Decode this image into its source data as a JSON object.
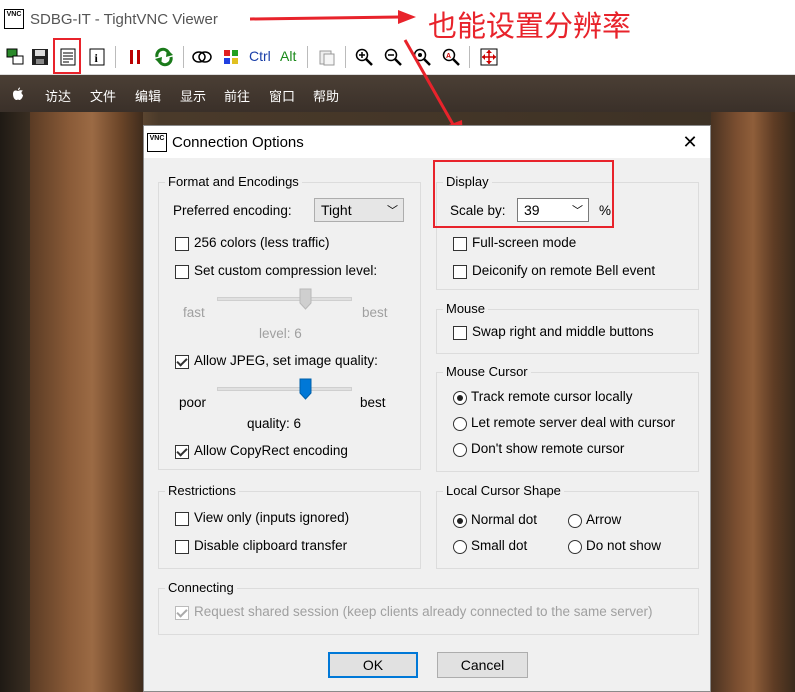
{
  "window": {
    "title": "SDBG-IT - TightVNC Viewer",
    "icon_text": "VNC"
  },
  "annotation": {
    "text": "也能设置分辨率",
    "color": "#e8232b"
  },
  "toolbar": {
    "ctrl_label": "Ctrl",
    "alt_label": "Alt"
  },
  "mac_menu": {
    "items": [
      "访达",
      "文件",
      "编辑",
      "显示",
      "前往",
      "窗口",
      "帮助"
    ]
  },
  "dialog": {
    "title": "Connection Options",
    "icon_text": "VNC",
    "format": {
      "title": "Format and Encodings",
      "preferred_encoding_label": "Preferred encoding:",
      "preferred_encoding_value": "Tight",
      "colors256": {
        "label": "256 colors (less traffic)",
        "checked": false
      },
      "custom_compression": {
        "label": "Set custom compression level:",
        "checked": false
      },
      "compression": {
        "fast": "fast",
        "best": "best",
        "level_text": "level: 6",
        "level": 6,
        "max": 9
      },
      "allow_jpeg": {
        "label": "Allow JPEG, set image quality:",
        "checked": true
      },
      "quality": {
        "poor": "poor",
        "best": "best",
        "quality_text": "quality: 6",
        "level": 6,
        "max": 9
      },
      "copyrect": {
        "label": "Allow CopyRect encoding",
        "checked": true
      }
    },
    "restrictions": {
      "title": "Restrictions",
      "view_only": {
        "label": "View only (inputs ignored)",
        "checked": false
      },
      "disable_clipboard": {
        "label": "Disable clipboard transfer",
        "checked": false
      }
    },
    "connecting": {
      "title": "Connecting",
      "shared": {
        "label": "Request shared session (keep clients already connected to the same server)",
        "checked": true
      }
    },
    "display": {
      "title": "Display",
      "scale_label": "Scale by:",
      "scale_value": "39",
      "percent": "%",
      "fullscreen": {
        "label": "Full-screen mode",
        "checked": false
      },
      "deiconify": {
        "label": "Deiconify on remote Bell event",
        "checked": false
      }
    },
    "mouse": {
      "title": "Mouse",
      "swap": {
        "label": "Swap right and middle buttons",
        "checked": false
      }
    },
    "mouse_cursor": {
      "title": "Mouse Cursor",
      "options": [
        "Track remote cursor locally",
        "Let remote server deal with cursor",
        "Don't show remote cursor"
      ],
      "selected": 0
    },
    "local_cursor": {
      "title": "Local Cursor Shape",
      "options": [
        "Normal dot",
        "Arrow",
        "Small dot",
        "Do not show"
      ],
      "selected": 0
    },
    "ok_label": "OK",
    "cancel_label": "Cancel"
  }
}
